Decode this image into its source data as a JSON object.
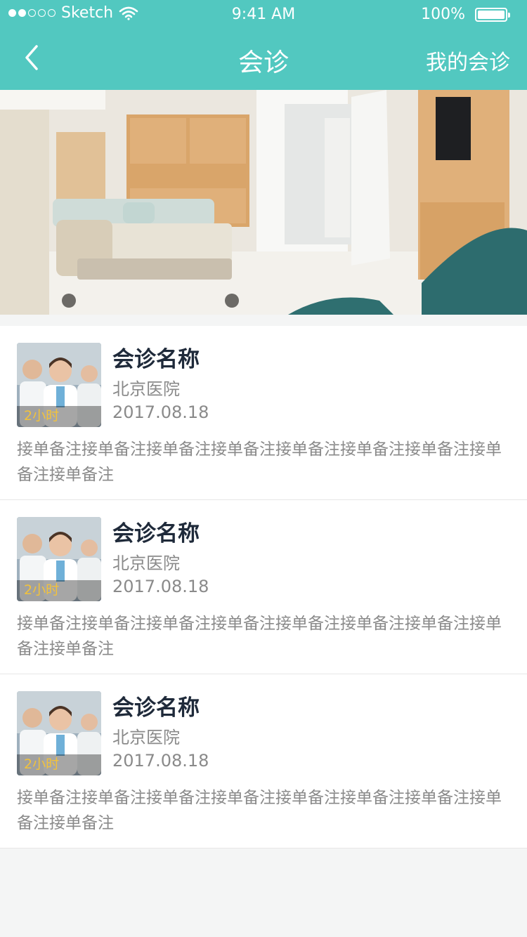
{
  "status_bar": {
    "carrier": "Sketch",
    "time": "9:41 AM",
    "battery": "100%"
  },
  "nav": {
    "title": "会诊",
    "right_link": "我的会诊"
  },
  "consultations": [
    {
      "title": "会诊名称",
      "hospital": "北京医院",
      "date": "2017.08.18",
      "badge": "2小时",
      "note": "接单备注接单备注接单备注接单备注接单备注接单备注接单备注接单备注接单备注"
    },
    {
      "title": "会诊名称",
      "hospital": "北京医院",
      "date": "2017.08.18",
      "badge": "2小时",
      "note": "接单备注接单备注接单备注接单备注接单备注接单备注接单备注接单备注接单备注"
    },
    {
      "title": "会诊名称",
      "hospital": "北京医院",
      "date": "2017.08.18",
      "badge": "2小时",
      "note": "接单备注接单备注接单备注接单备注接单备注接单备注接单备注接单备注接单备注"
    }
  ],
  "colors": {
    "header": "#52c8c0",
    "title_text": "#1f2a3a",
    "meta_text": "#8a8a8a",
    "badge": "#f2c23b"
  }
}
